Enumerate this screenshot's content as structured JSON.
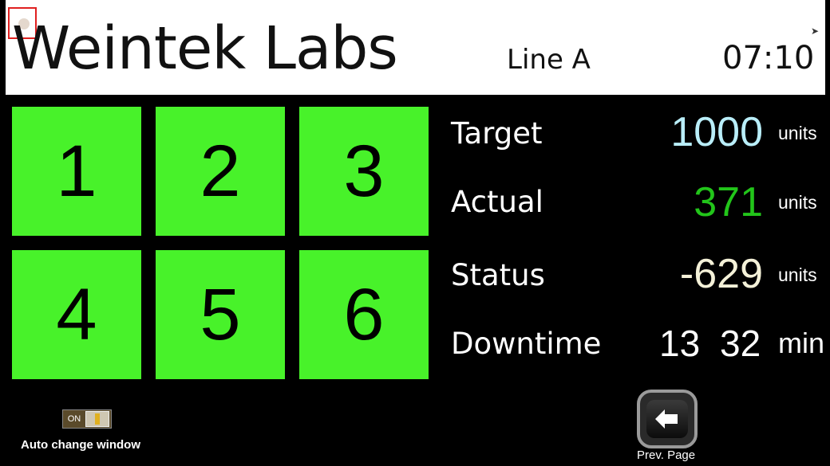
{
  "header": {
    "brand": "Weintek Labs",
    "line_name": "Line A",
    "clock": "07:10"
  },
  "tiles": [
    "1",
    "2",
    "3",
    "4",
    "5",
    "6"
  ],
  "colors": {
    "tile_green": "#48f22a",
    "target_blue": "#b9eef9",
    "actual_green": "#22c51a",
    "status_cream": "#f4f1d8",
    "white": "#ffffff"
  },
  "metrics": {
    "target": {
      "label": "Target",
      "value": "1000",
      "unit": "units"
    },
    "actual": {
      "label": "Actual",
      "value": "371",
      "unit": "units"
    },
    "status": {
      "label": "Status",
      "value": "-629",
      "unit": "units"
    },
    "downtime": {
      "label": "Downtime",
      "hours": "13",
      "minutes": "32",
      "unit": "min"
    }
  },
  "toggle": {
    "state_label": "ON",
    "caption": "Auto change window"
  },
  "prev_page": {
    "caption": "Prev. Page",
    "icon": "arrow-left-icon"
  }
}
